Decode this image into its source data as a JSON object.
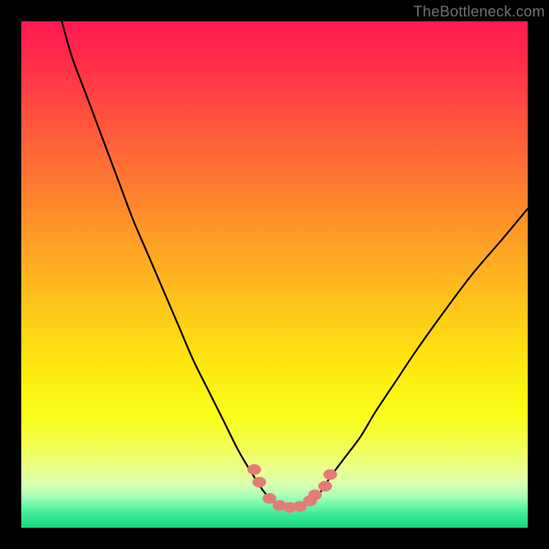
{
  "watermark": "TheBottleneck.com",
  "chart_data": {
    "type": "line",
    "title": "",
    "xlabel": "",
    "ylabel": "",
    "xlim": [
      0,
      100
    ],
    "ylim": [
      0,
      100
    ],
    "series": [
      {
        "name": "bottleneck-curve",
        "x": [
          8,
          10,
          13,
          16,
          19,
          22,
          25,
          28,
          31,
          34,
          37,
          40,
          43,
          46,
          48,
          50,
          52,
          54,
          56,
          59,
          61,
          64,
          67,
          70,
          74,
          78,
          83,
          89,
          95,
          100
        ],
        "y": [
          100,
          93,
          85,
          77,
          69,
          61,
          54,
          47,
          40,
          33,
          27,
          21,
          15,
          10,
          7,
          5,
          4,
          4,
          5,
          7,
          10,
          14,
          18,
          23,
          29,
          35,
          42,
          50,
          57,
          63
        ]
      }
    ],
    "markers": {
      "name": "highlight-points",
      "x": [
        46,
        47,
        49,
        51,
        53,
        55,
        57,
        58,
        60,
        61
      ],
      "y": [
        11.5,
        9,
        5.8,
        4.4,
        4,
        4.2,
        5.3,
        6.5,
        8.2,
        10.5
      ]
    },
    "background_gradient_stops": [
      {
        "pos": 0.0,
        "color": "#ff1a4f"
      },
      {
        "pos": 0.07,
        "color": "#ff2a4a"
      },
      {
        "pos": 0.18,
        "color": "#ff4e3f"
      },
      {
        "pos": 0.3,
        "color": "#ff7433"
      },
      {
        "pos": 0.42,
        "color": "#ff9a27"
      },
      {
        "pos": 0.55,
        "color": "#ffc21b"
      },
      {
        "pos": 0.68,
        "color": "#ffe80f"
      },
      {
        "pos": 0.78,
        "color": "#f9ff1a"
      },
      {
        "pos": 0.84,
        "color": "#f2ff55"
      },
      {
        "pos": 0.885,
        "color": "#eaff8f"
      },
      {
        "pos": 0.915,
        "color": "#d6ffb0"
      },
      {
        "pos": 0.935,
        "color": "#b0ffb8"
      },
      {
        "pos": 0.955,
        "color": "#70f7a8"
      },
      {
        "pos": 0.975,
        "color": "#3be892"
      },
      {
        "pos": 1.0,
        "color": "#18d87e"
      }
    ],
    "marker_color": "#e57b78",
    "curve_color": "#000000"
  }
}
